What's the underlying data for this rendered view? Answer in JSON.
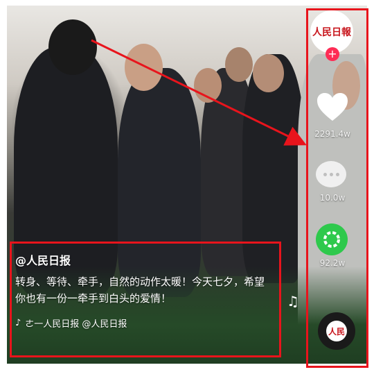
{
  "account": {
    "avatar_text": "人民日報"
  },
  "actions": {
    "like_count": "2291.4w",
    "comment_count": "10.0w",
    "share_count": "92.2w"
  },
  "caption": {
    "handle": "@人民日报",
    "text": "转身、等待、牵手，自然的动作太暖！今天七夕，希望你也有一份一牵手到白头的爱情！",
    "music": "ㄜ一人民日报   @人民日报"
  },
  "music_disc_text": "人民",
  "colors": {
    "annotation": "#e8141c",
    "like": "#ffffff",
    "share": "#2ec94c",
    "follow": "#fe2c55"
  },
  "icons": [
    "heart-icon",
    "comment-icon",
    "share-icon",
    "music-note-icon",
    "tiktok-logo-icon",
    "plus-icon"
  ]
}
